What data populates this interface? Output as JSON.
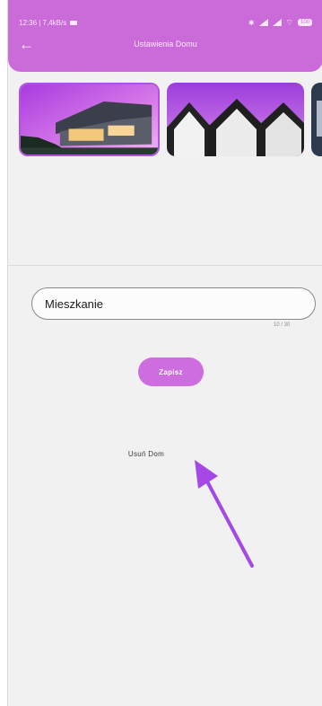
{
  "status_bar": {
    "time_speed": "12:36 | 7,4kB/s",
    "battery": "100"
  },
  "appbar": {
    "title": "Ustawienia Domu",
    "back_icon": "arrow-left-icon",
    "color": "#cb6ad9"
  },
  "gallery": {
    "images": [
      "modern-house-image",
      "gabled-houses-image",
      "house-image-partial"
    ],
    "selected_index": 0
  },
  "form": {
    "name_value": "Mieszkanie",
    "counter": "10 / 30",
    "save_label": "Zapisz",
    "delete_label": "Usuń Dom"
  },
  "colors": {
    "accent": "#cd6de0",
    "annotation_arrow": "#a549e6"
  }
}
